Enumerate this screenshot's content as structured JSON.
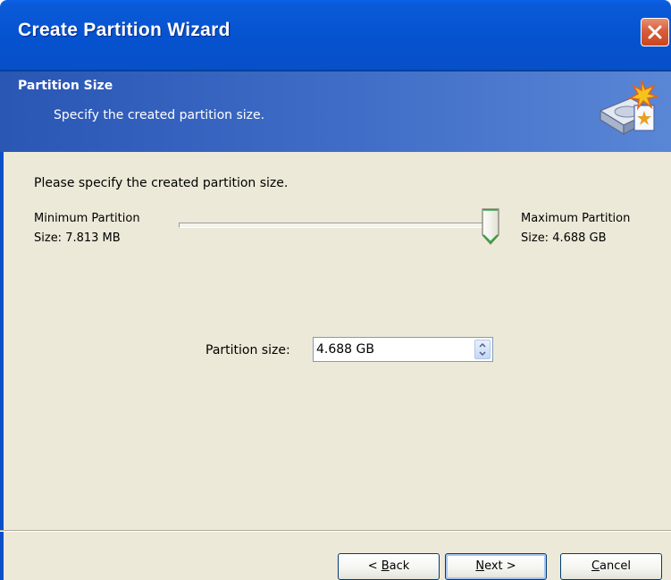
{
  "window": {
    "title": "Create Partition Wizard"
  },
  "header": {
    "title": "Partition Size",
    "subtitle": "Specify the created partition size.",
    "icon": "disk-wizard-icon"
  },
  "content": {
    "instruction": "Please specify the created partition size.",
    "min_label_line1": "Minimum Partition",
    "min_label_line2": "Size: 7.813 MB",
    "max_label_line1": "Maximum Partition",
    "max_label_line2": "Size: 4.688 GB",
    "slider_position_fraction": 1.0,
    "size_label": "Partition size:",
    "size_value": "4.688 GB"
  },
  "buttons": {
    "back_prefix": "< ",
    "back_accel": "B",
    "back_rest": "ack",
    "next_accel": "N",
    "next_rest": "ext >",
    "cancel_accel": "C",
    "cancel_rest": "ancel"
  },
  "colors": {
    "titlebar": "#0653d0",
    "header_bg": "#3e6cc6",
    "body_bg": "#ece9d8",
    "close_button": "#d85d3c"
  }
}
